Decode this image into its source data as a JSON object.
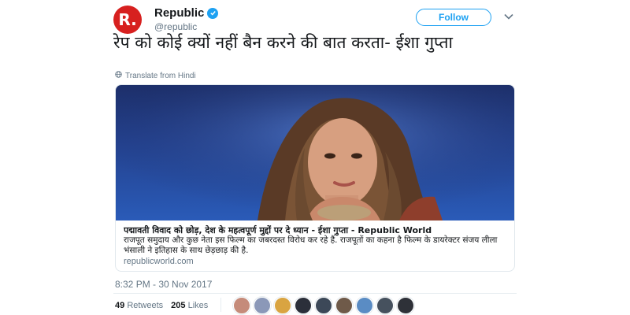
{
  "account": {
    "avatar_letter": "R.",
    "name": "Republic",
    "handle": "@republic",
    "follow_label": "Follow"
  },
  "tweet": {
    "text": "रेप को कोई क्यों नहीं बैन करने की बात करता- ईशा गुप्ता",
    "translate_label": "Translate from Hindi",
    "timestamp": "8:32 PM - 30 Nov 2017"
  },
  "card": {
    "title": "पद्मावती विवाद को छोड़, देश के महत्वपूर्ण मुद्दों पर दे ध्यान - ईशा गुप्ता - Republic World",
    "description": "राजपूत समुदाय और कुछ नेता इस फिल्म का जबरदस्त विरोध कर रहे हैं. राजपूतों का कहना है फिल्म के डायरेक्टर संजय लीला भंसाली ने इतिहास के साथ छेड़छाड़ की है.",
    "domain": "republicworld.com"
  },
  "stats": {
    "retweets_count": "49",
    "retweets_label": "Retweets",
    "likes_count": "205",
    "likes_label": "Likes"
  },
  "icons": {
    "verified": "verified-badge-icon",
    "caret": "chevron-down-icon",
    "translate": "globe-icon"
  },
  "colors": {
    "brand_red": "#d7201f",
    "twitter_blue": "#1da1f2",
    "muted_text": "#657786"
  },
  "liker_avatars": [
    {
      "color": "#c58b7a"
    },
    {
      "color": "#8b98b8"
    },
    {
      "color": "#d9a441"
    },
    {
      "color": "#2b2f3a"
    },
    {
      "color": "#3c4858"
    },
    {
      "color": "#6f5a49"
    },
    {
      "color": "#5a8cc4"
    },
    {
      "color": "#46515e"
    },
    {
      "color": "#2e3138"
    }
  ]
}
